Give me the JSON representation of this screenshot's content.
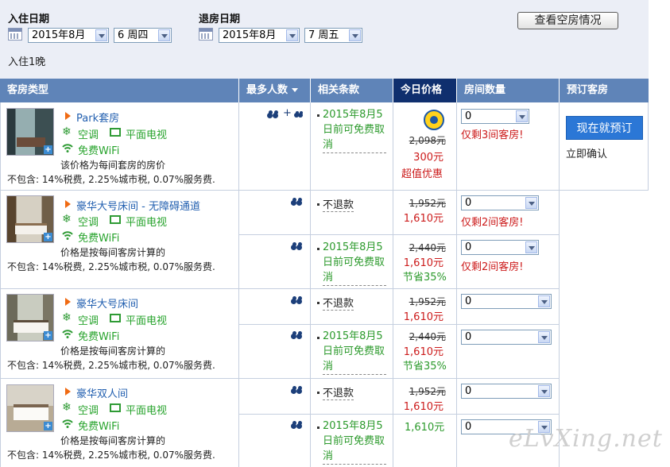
{
  "search": {
    "checkin_label": "入住日期",
    "checkout_label": "退房日期",
    "checkin_month": "2015年8月",
    "checkin_day": "6 周四",
    "checkout_month": "2015年8月",
    "checkout_day": "7 周五",
    "check_button": "查看空房情况",
    "nights": "入住1晚"
  },
  "table_headers": {
    "room_type": "客房类型",
    "max_people": "最多人数",
    "conditions": "相关条款",
    "today_price": "今日价格",
    "room_count": "房间数量",
    "book": "预订客房"
  },
  "amenities": {
    "ac": "空调",
    "tv": "平面电视",
    "wifi": "免费WiFi"
  },
  "tax_note": "不包含: 14%税费, 2.25%城市税, 0.07%服务费.",
  "rooms": [
    {
      "name": "Park套房",
      "note": "该价格为每间套房的房价",
      "offers": [
        {
          "condition": "2015年8月5日前可免费取消",
          "old_price": "2,098元",
          "new_price": "300元",
          "extra": "超值优惠",
          "qty": "0",
          "warning": "仅剩3间客房!"
        }
      ]
    },
    {
      "name": "豪华大号床间 - 无障碍通道",
      "note": "价格是按每间客房计算的",
      "offers": [
        {
          "condition": "不退款",
          "old_price": "1,952元",
          "new_price": "1,610元",
          "qty": "0",
          "warning": "仅剩2间客房!"
        },
        {
          "condition": "2015年8月5日前可免费取消",
          "old_price": "2,440元",
          "new_price": "1,610元",
          "extra": "节省35%",
          "qty": "0",
          "warning": "仅剩2间客房!"
        }
      ]
    },
    {
      "name": "豪华大号床间",
      "note": "价格是按每间客房计算的",
      "offers": [
        {
          "condition": "不退款",
          "old_price": "1,952元",
          "new_price": "1,610元",
          "qty": "0"
        },
        {
          "condition": "2015年8月5日前可免费取消",
          "old_price": "2,440元",
          "new_price": "1,610元",
          "extra": "节省35%",
          "qty": "0"
        }
      ]
    },
    {
      "name": "豪华双人间",
      "note": "价格是按每间客房计算的",
      "offers": [
        {
          "condition": "不退款",
          "old_price": "1,952元",
          "new_price": "1,610元",
          "qty": "0"
        },
        {
          "condition": "2015年8月5日前可免费取消",
          "price": "1,610元",
          "qty": "0"
        }
      ]
    }
  ],
  "booking": {
    "book_now": "现在就预订",
    "instant_confirm": "立即确认"
  },
  "watermark": "eLvXing.net",
  "colors": {
    "header_bg": "#5f84b8",
    "today_header_bg": "#0f2f6e",
    "link": "#2360b0",
    "green": "#2c9a2c",
    "red": "#cc1a1a",
    "book_button": "#2b77d6"
  }
}
